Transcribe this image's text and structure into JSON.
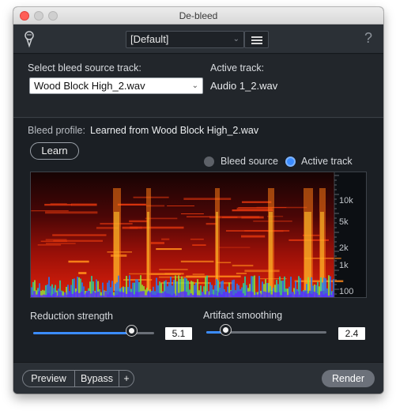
{
  "window": {
    "title": "De-bleed"
  },
  "toolbar": {
    "preset_value": "[Default]",
    "help_label": "?"
  },
  "source": {
    "select_label": "Select bleed source track:",
    "select_value": "Wood Block High_2.wav",
    "active_label": "Active track:",
    "active_value": "Audio 1_2.wav"
  },
  "profile": {
    "label": "Bleed profile:",
    "value": "Learned from Wood Block High_2.wav",
    "learn_label": "Learn",
    "view_options": [
      "Bleed source",
      "Active track"
    ],
    "selected_view": "Active track"
  },
  "spectrogram": {
    "freq_labels": [
      "10k",
      "5k",
      "2k",
      "1k",
      "100"
    ]
  },
  "controls": {
    "reduction": {
      "label": "Reduction strength",
      "value": "5.1",
      "fraction": 0.81
    },
    "artifact": {
      "label": "Artifact smoothing",
      "value": "2.4",
      "fraction": 0.16
    }
  },
  "footer": {
    "preview_label": "Preview",
    "bypass_label": "Bypass",
    "plus_label": "+",
    "render_label": "Render"
  },
  "colors": {
    "accent": "#3b8cff",
    "panel_dark": "#1b1f24",
    "toolbar": "#2b3036"
  }
}
